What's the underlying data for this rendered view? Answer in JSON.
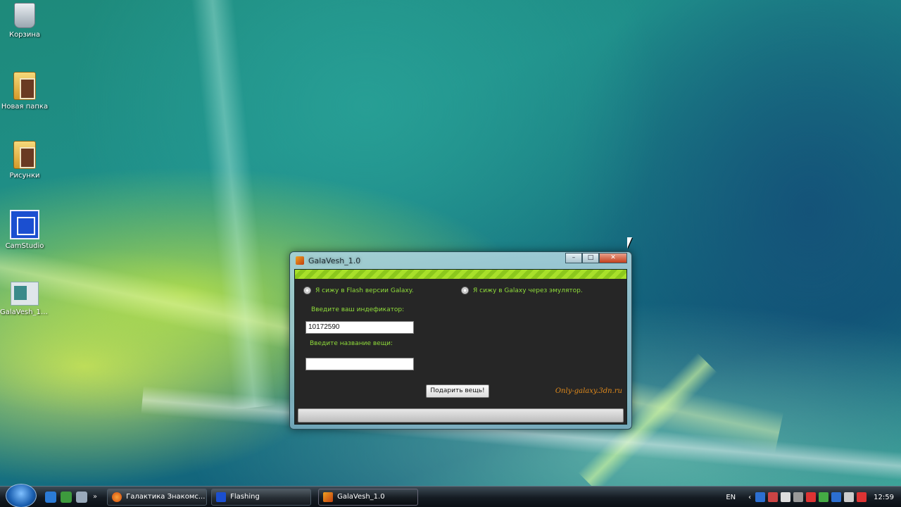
{
  "desktop": {
    "icons": [
      {
        "label": "Корзина",
        "icon": "recycle-bin-icon"
      },
      {
        "label": "Новая папка",
        "icon": "folder-icon"
      },
      {
        "label": "Рисунки",
        "icon": "folder-icon"
      },
      {
        "label": "CamStudio",
        "icon": "camstudio-icon"
      },
      {
        "label": "GalaVesh_1....",
        "icon": "app-icon"
      }
    ]
  },
  "window": {
    "title": "GalaVesh_1.0",
    "radio_flash": "Я сижу в Flash версии Galaxy.",
    "radio_emulator": "Я сижу в Galaxy через эмулятор.",
    "id_label": "Введите ваш индефикатор:",
    "id_value": "10172590",
    "item_label": "Введите название вещи:",
    "item_value": "",
    "gift_button": "Подарить вещь!",
    "site_text": "Only-galaxy.3dn.ru",
    "progress": 0
  },
  "taskbar": {
    "tasks": [
      {
        "label": "Галактика Знакомс...",
        "icon": "firefox-icon",
        "active": false
      },
      {
        "label": "Flashing",
        "icon": "camstudio-icon",
        "active": false
      },
      {
        "label": "GalaVesh_1.0",
        "icon": "app-icon",
        "active": true
      }
    ],
    "language": "EN",
    "clock": "12:59"
  },
  "colors": {
    "accent_green": "#8fdc3a",
    "site_orange": "#e08a1c",
    "client_bg": "#262626"
  }
}
